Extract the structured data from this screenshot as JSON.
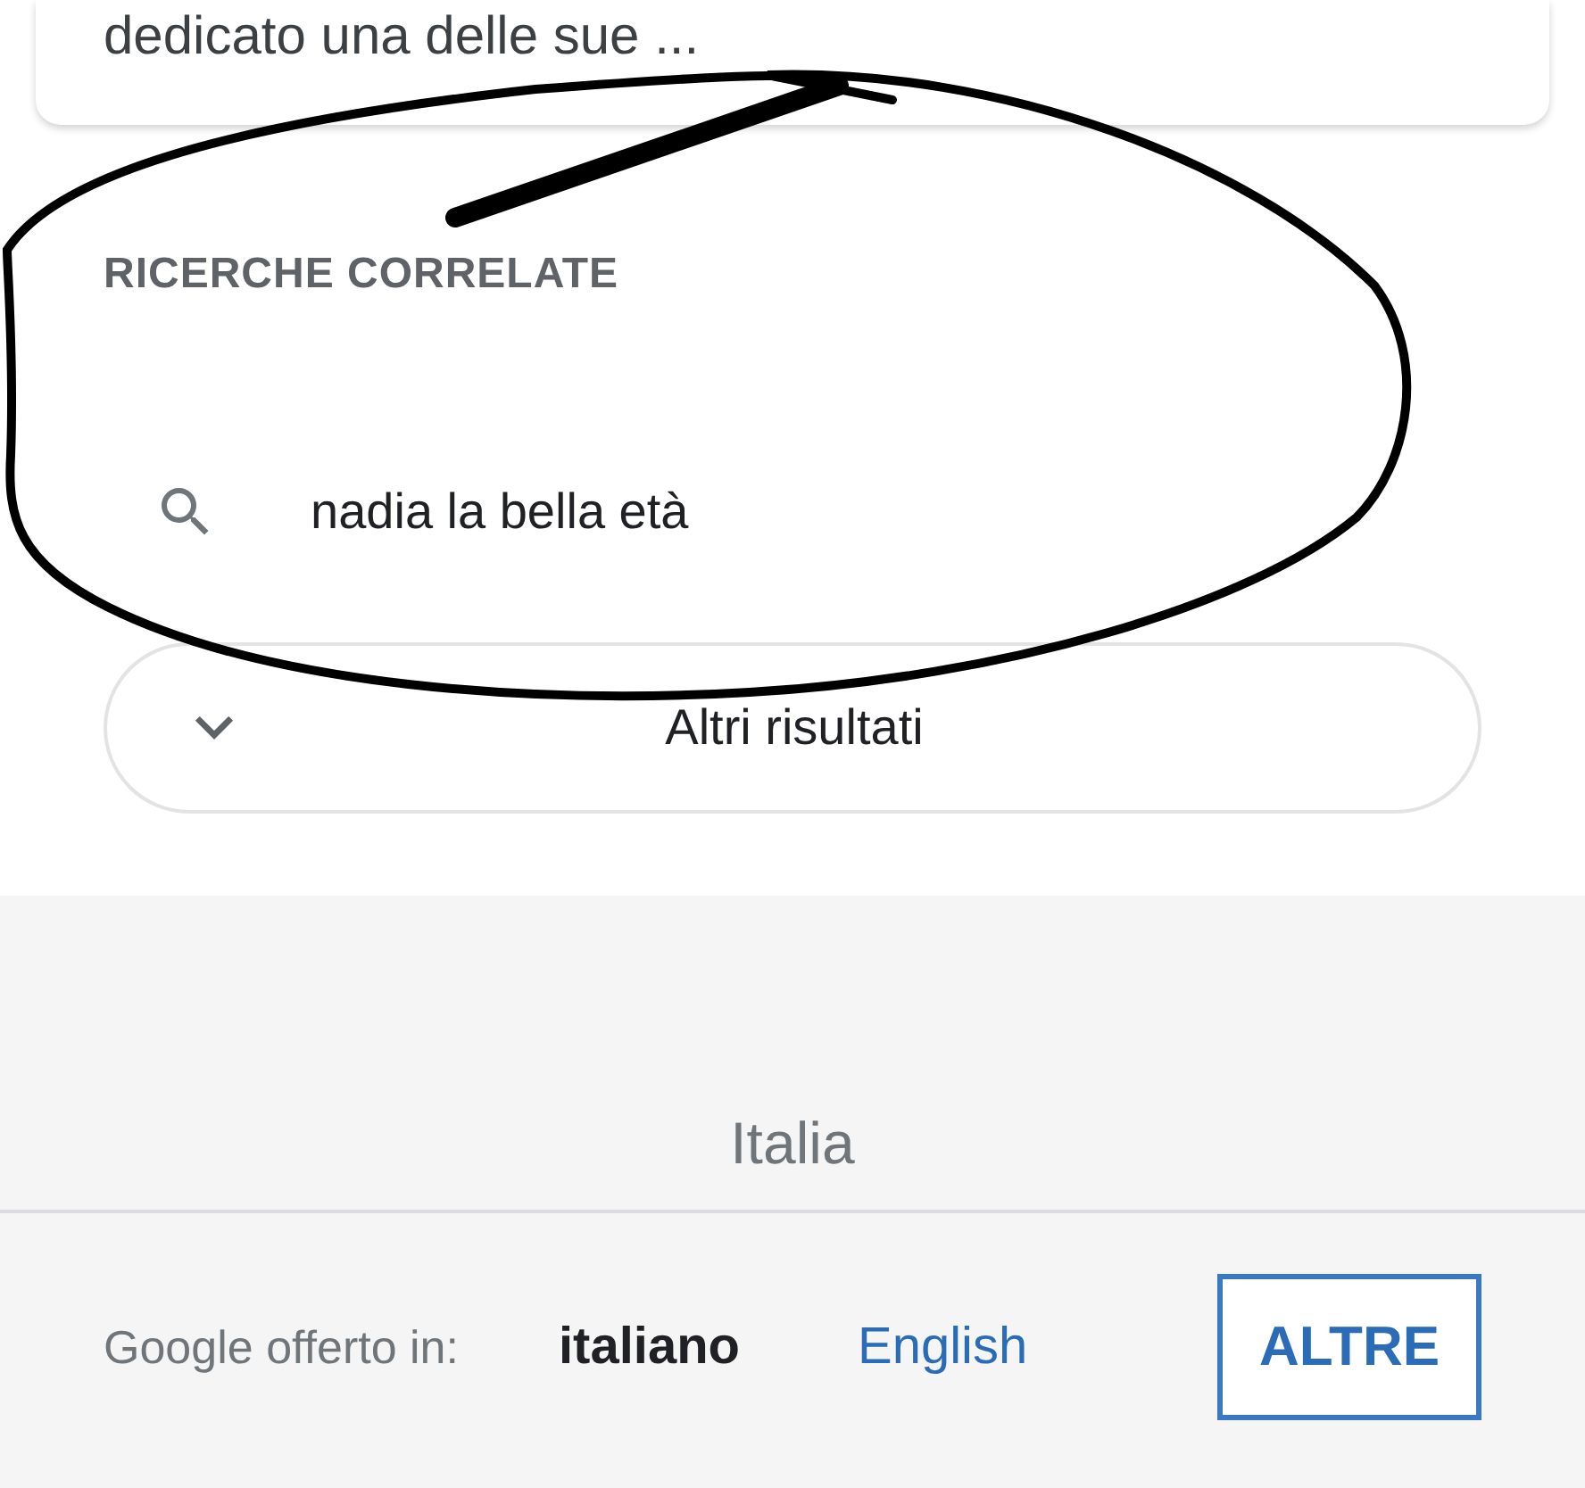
{
  "result_card": {
    "snippet": "dedicato una delle sue ..."
  },
  "related_searches": {
    "heading": "RICERCHE CORRELATE",
    "items": [
      {
        "text": "nadia la bella età"
      }
    ]
  },
  "more_results_button": {
    "label": "Altri risultati"
  },
  "footer": {
    "region": "Italia",
    "language_prompt": "Google offerto in:",
    "languages": [
      {
        "label": "italiano",
        "selected": true
      },
      {
        "label": "English",
        "selected": false
      }
    ],
    "more_button": "ALTRE"
  },
  "annotation": {
    "kind": "circle"
  }
}
